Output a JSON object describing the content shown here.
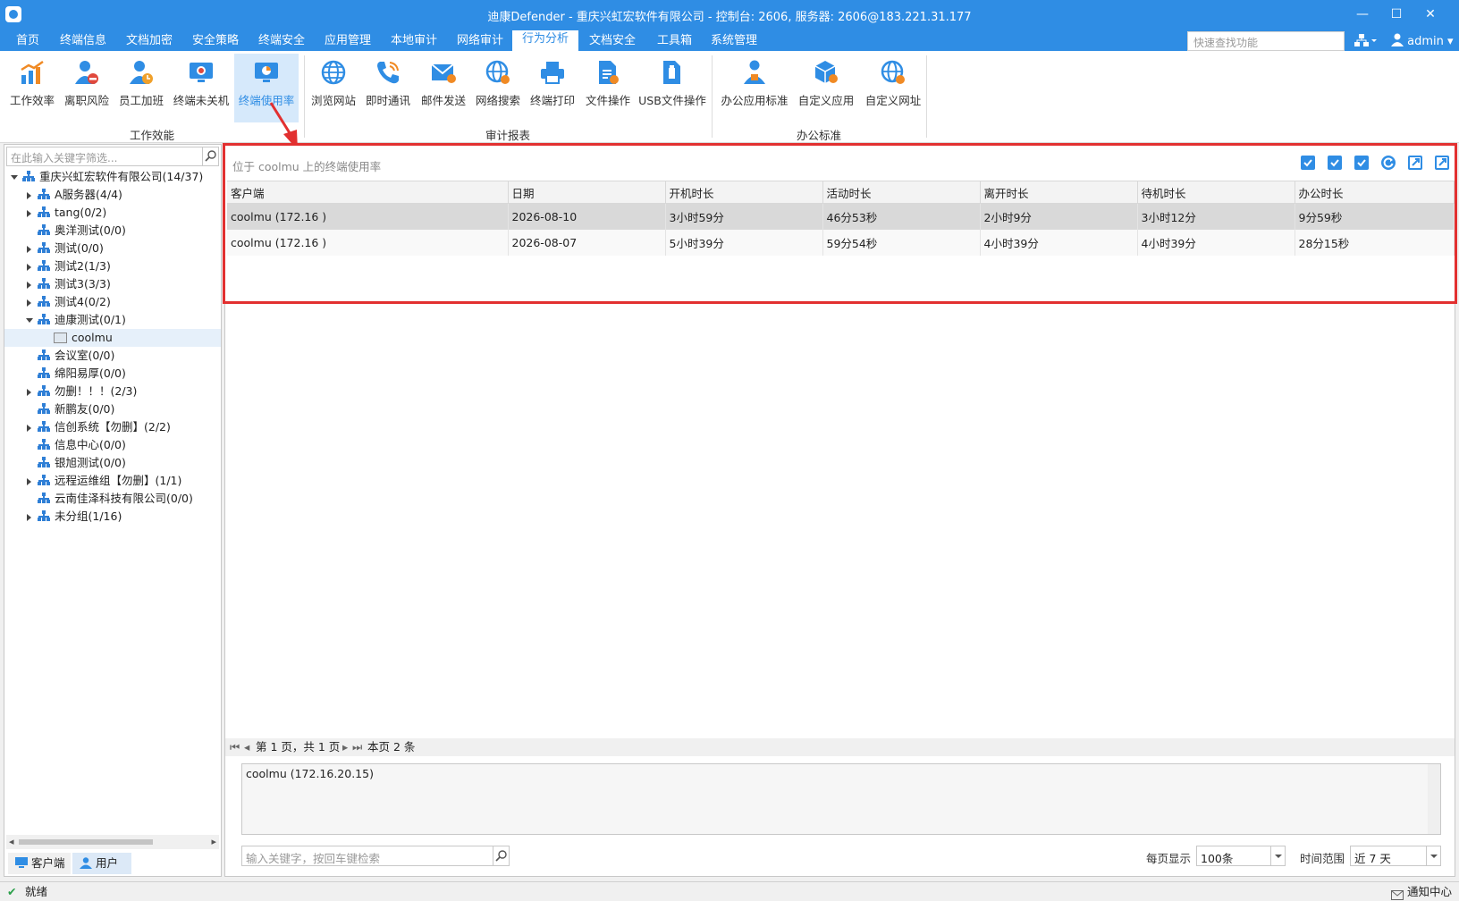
{
  "window": {
    "title": "迪康Defender - 重庆兴虹宏软件有限公司 - 控制台: 2606, 服务器: 2606@183.221.31.177",
    "min": "—",
    "max": "☐",
    "close": "✕"
  },
  "menu": {
    "tabs": [
      "首页",
      "终端信息",
      "文档加密",
      "安全策略",
      "终端安全",
      "应用管理",
      "本地审计",
      "网络审计",
      "行为分析",
      "文档安全",
      "工具箱",
      "系统管理"
    ],
    "active_index": 8,
    "quick_search_placeholder": "快速查找功能",
    "user": "admin"
  },
  "ribbon": {
    "buttons": [
      "工作效率",
      "离职风险",
      "员工加班",
      "终端未关机",
      "终端使用率",
      "浏览网站",
      "即时通讯",
      "邮件发送",
      "网络搜索",
      "终端打印",
      "文件操作",
      "USB文件操作",
      "办公应用标准",
      "自定义应用",
      "自定义网址"
    ],
    "selected": "终端使用率",
    "groups": [
      "工作效能",
      "审计报表",
      "办公标准"
    ]
  },
  "tree": {
    "filter_placeholder": "在此输入关键字筛选...",
    "root": "重庆兴虹宏软件有限公司(14/37)",
    "items": [
      {
        "label": "A服务器(4/4)",
        "expand": "collapsed"
      },
      {
        "label": "tang(0/2)",
        "expand": "collapsed"
      },
      {
        "label": "奥洋测试(0/0)",
        "expand": "none"
      },
      {
        "label": "测试(0/0)",
        "expand": "collapsed"
      },
      {
        "label": "测试2(1/3)",
        "expand": "collapsed"
      },
      {
        "label": "测试3(3/3)",
        "expand": "collapsed"
      },
      {
        "label": "测试4(0/2)",
        "expand": "collapsed"
      },
      {
        "label": "迪康测试(0/1)",
        "expand": "expanded"
      },
      {
        "label": "coolmu",
        "expand": "leaf"
      },
      {
        "label": "会议室(0/0)",
        "expand": "none"
      },
      {
        "label": "绵阳易厚(0/0)",
        "expand": "none"
      },
      {
        "label": "勿删！！！(2/3)",
        "expand": "collapsed"
      },
      {
        "label": "新鹏友(0/0)",
        "expand": "none"
      },
      {
        "label": "信创系统【勿删】(2/2)",
        "expand": "collapsed"
      },
      {
        "label": "信息中心(0/0)",
        "expand": "none"
      },
      {
        "label": "银旭测试(0/0)",
        "expand": "none"
      },
      {
        "label": "远程运维组【勿删】(1/1)",
        "expand": "collapsed"
      },
      {
        "label": "云南佳泽科技有限公司(0/0)",
        "expand": "none"
      },
      {
        "label": "未分组(1/16)",
        "expand": "collapsed"
      }
    ],
    "selected": "coolmu",
    "bottom_tabs": [
      "客户端",
      "用户"
    ]
  },
  "report": {
    "location": "位于 coolmu 上的终端使用率",
    "columns": [
      "客户端",
      "日期",
      "开机时长",
      "活动时长",
      "离开时长",
      "待机时长",
      "办公时长"
    ],
    "rows": [
      [
        "coolmu (172.16      )",
        "2026-08-10",
        "3小时59分",
        "46分53秒",
        "2小时9分",
        "3小时12分",
        "9分59秒"
      ],
      [
        "coolmu (172.16      )",
        "2026-08-07",
        "5小时39分",
        "59分54秒",
        "4小时39分",
        "4小时39分",
        "28分15秒"
      ]
    ],
    "pager_text": "第 1 页，共 1 页",
    "page_count": "本页 2 条",
    "detail": "coolmu (172.16.20.15)",
    "keyword_placeholder": "输入关键字，按回车键检索",
    "per_page_label": "每页显示",
    "per_page": "100条",
    "time_range_label": "时间范围",
    "time_range": "近 7 天"
  },
  "status": {
    "left": "就绪",
    "right": "通知中心"
  },
  "colors": {
    "accent": "#2f8de4",
    "highlight_box": "#e23030",
    "selected_row": "#d9d9d9"
  }
}
